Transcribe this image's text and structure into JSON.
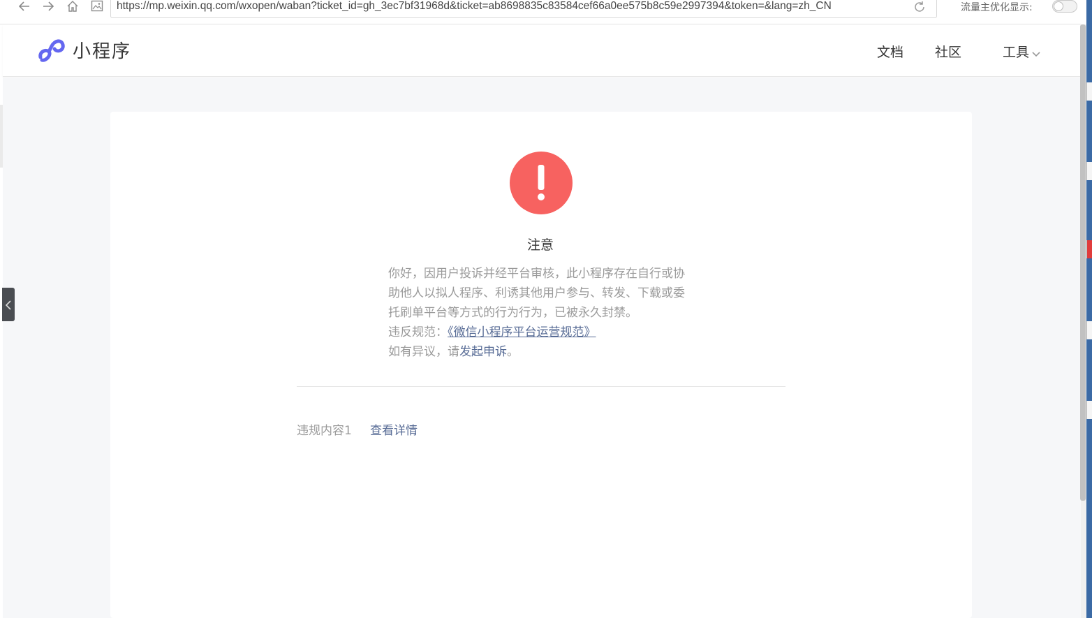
{
  "browser": {
    "url": "https://mp.weixin.qq.com/wxopen/waban?ticket_id=gh_3ec7bf31968d&ticket=ab8698835c83584cef66a0ee575b8c59e2997394&token=&lang=zh_CN",
    "opt_label": "流量主优化显示:",
    "toggle_on": false
  },
  "header": {
    "logo_text": "小程序",
    "nav": {
      "docs": "文档",
      "community": "社区",
      "tools": "工具"
    },
    "accent_color": "#6467f0"
  },
  "notice": {
    "title": "注意",
    "icon": "exclamation-circle-icon",
    "icon_color": "#f76260",
    "lines": [
      "你好，因用户投诉并经平台审核，此小程序存在自行或协",
      "助他人以拟人程序、利诱其他用户参与、转发、下载或委",
      "托刷单平台等方式的行为行为，已被永久封禁。"
    ],
    "rule_prefix": "违反规范：",
    "rule_link": "《微信小程序平台运营规范》",
    "appeal_prefix": "如有异议，请",
    "appeal_link": "发起申诉",
    "appeal_suffix": "。"
  },
  "violation": {
    "label": "违规内容1",
    "link": "查看详情"
  },
  "link_color": "#576b95"
}
